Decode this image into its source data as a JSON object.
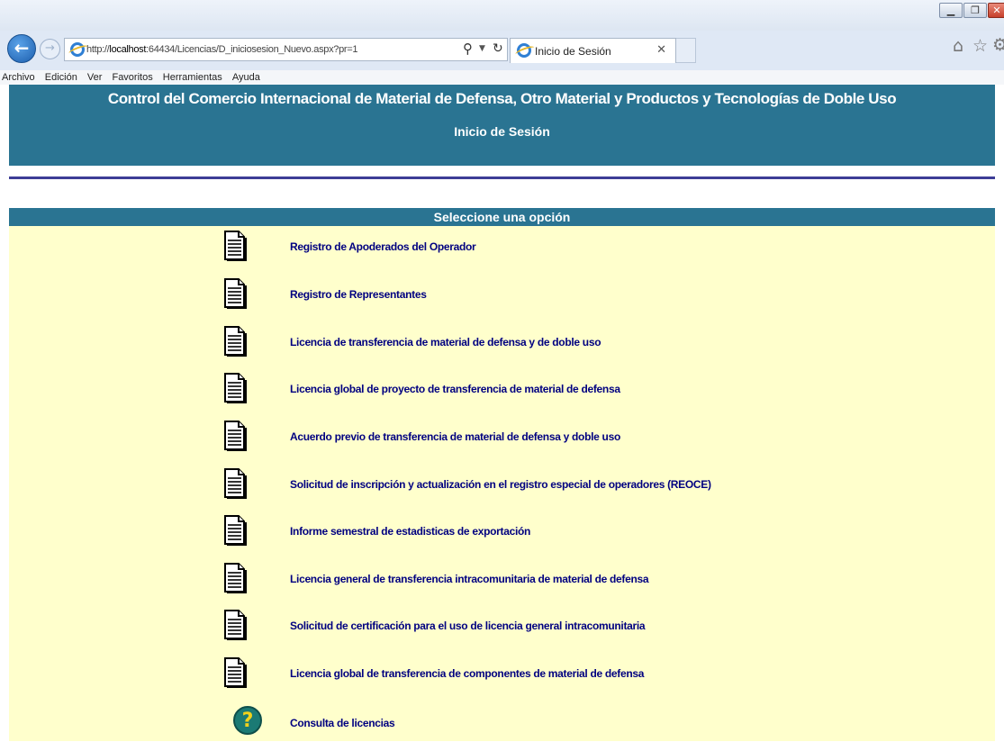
{
  "browser": {
    "url_prefix": "http://",
    "url_host": "localhost",
    "url_rest": ":64434/Licencias/D_iniciosesion_Nuevo.aspx?pr=1",
    "tab_title": "Inicio de Sesión",
    "menu": [
      "Archivo",
      "Edición",
      "Ver",
      "Favoritos",
      "Herramientas",
      "Ayuda"
    ],
    "icons": [
      "back-arrow-icon",
      "forward-arrow-icon",
      "ie-logo-icon",
      "search-icon",
      "refresh-icon",
      "close-icon",
      "home-icon",
      "star-icon",
      "gear-icon"
    ]
  },
  "header": {
    "title": "Control del Comercio Internacional de Material de Defensa, Otro Material y Productos y Tecnologías de Doble Uso",
    "subtitle": "Inicio de Sesión"
  },
  "options": {
    "title": "Seleccione una opción",
    "items": [
      {
        "label": "Registro de Apoderados del Operador",
        "icon": "document-icon"
      },
      {
        "label": "Registro de Representantes",
        "icon": "document-icon"
      },
      {
        "label": "Licencia de transferencia de material de defensa y de doble uso",
        "icon": "document-icon"
      },
      {
        "label": "Licencia global de proyecto de transferencia de material de defensa",
        "icon": "document-icon"
      },
      {
        "label": "Acuerdo previo de transferencia de material de defensa y doble uso",
        "icon": "document-icon"
      },
      {
        "label": "Solicitud de inscripción y actualización en el registro especial de operadores (REOCE)",
        "icon": "document-icon"
      },
      {
        "label": "Informe semestral de estadisticas de exportación",
        "icon": "document-icon"
      },
      {
        "label": "Licencia general de transferencia intracomunitaria de material de defensa",
        "icon": "document-icon"
      },
      {
        "label": "Solicitud de certificación para el uso de licencia general intracomunitaria",
        "icon": "document-icon"
      },
      {
        "label": "Licencia global de transferencia de componentes de material de defensa",
        "icon": "document-icon"
      },
      {
        "label": "Consulta de licencias",
        "icon": "help-icon"
      }
    ]
  },
  "colors": {
    "header_bg": "#2a7492",
    "panel_bg": "#ffffcc",
    "link": "#000080",
    "rule": "#3d3d96"
  }
}
